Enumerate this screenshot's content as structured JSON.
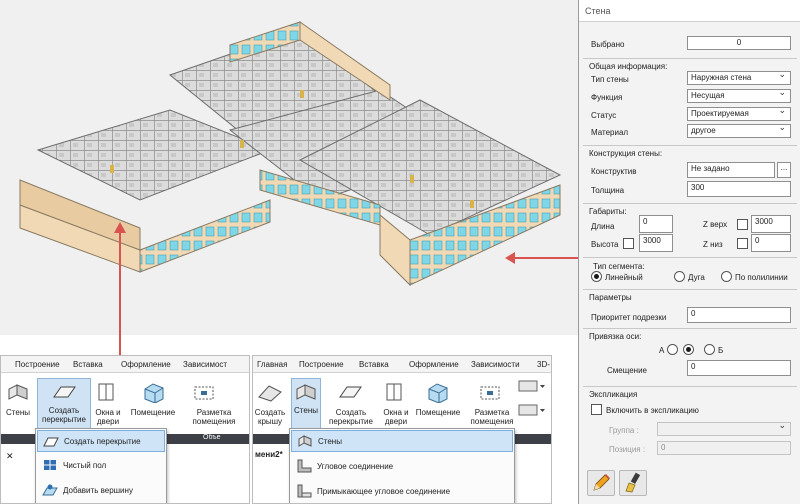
{
  "panel": {
    "title": "Стена",
    "selected_label": "Выбрано",
    "selected_value": "0",
    "general": {
      "header": "Общая информация:",
      "wall_type_label": "Тип стены",
      "wall_type_value": "Наружная стена",
      "function_label": "Функция",
      "function_value": "Несущая",
      "status_label": "Статус",
      "status_value": "Проектируемая",
      "material_label": "Материал",
      "material_value": "другое"
    },
    "construction": {
      "header": "Конструкция стены:",
      "constructive_label": "Конструктив",
      "constructive_value": "Не задано",
      "browse_label": "...",
      "thickness_label": "Толщина",
      "thickness_value": "300"
    },
    "dimensions": {
      "header": "Габариты:",
      "length_label": "Длина",
      "length_value": "0",
      "height_label": "Высота",
      "height_value": "3000",
      "ztop_label": "Z верх",
      "ztop_value": "3000",
      "zbottom_label": "Z низ",
      "zbottom_value": "0"
    },
    "segment": {
      "header": "Тип сегмента:",
      "options": [
        "Линейный",
        "Дуга",
        "По полилинии"
      ],
      "selected": "Линейный"
    },
    "params": {
      "header": "Параметры",
      "priority_label": "Приоритет подрезки",
      "priority_value": "0"
    },
    "axis": {
      "header": "Привязка оси:",
      "a_label": "А",
      "b_label": "Б",
      "offset_label": "Смещение",
      "offset_value": "0"
    },
    "explication": {
      "header": "Экспликация",
      "include_label": "Включить в экспликацию",
      "group_label": "Группа :",
      "group_value": "",
      "position_label": "Позиция :",
      "position_value": "0"
    },
    "tools": [
      "pencil-icon",
      "brush-icon"
    ]
  },
  "ribbon_left": {
    "tabs": [
      "Построение",
      "Вставка",
      "Оформление",
      "Зависимост"
    ],
    "buttons": {
      "walls": "Стены",
      "create_floor": "Создать перекрытие",
      "windows_doors": "Окна и двери",
      "room": "Помещение",
      "markup_room": "Разметка помещения"
    },
    "bar_text": "Объе",
    "close_glyph": "✕",
    "menu": [
      "Создать перекрытие",
      "Чистый пол",
      "Добавить вершину"
    ]
  },
  "ribbon_right": {
    "tabs": [
      "Главная",
      "Построение",
      "Вставка",
      "Оформление",
      "Зависимости",
      "3D-"
    ],
    "buttons": {
      "create_roof": "Создать крышу",
      "walls": "Стены",
      "create_floor": "Создать перекрытие",
      "windows_doors": "Окна и двери",
      "room": "Помещение",
      "markup_room": "Разметка помещения"
    },
    "doc_tab": "мени2*",
    "menu": [
      "Стены",
      "Угловое соединение",
      "Примыкающее угловое соединение"
    ]
  },
  "colors": {
    "callout_red": "#d9534f",
    "highlight_blue": "#cfe4f7",
    "wall_facade": "#f1d9b5",
    "window_cyan": "#7fd6e6"
  }
}
